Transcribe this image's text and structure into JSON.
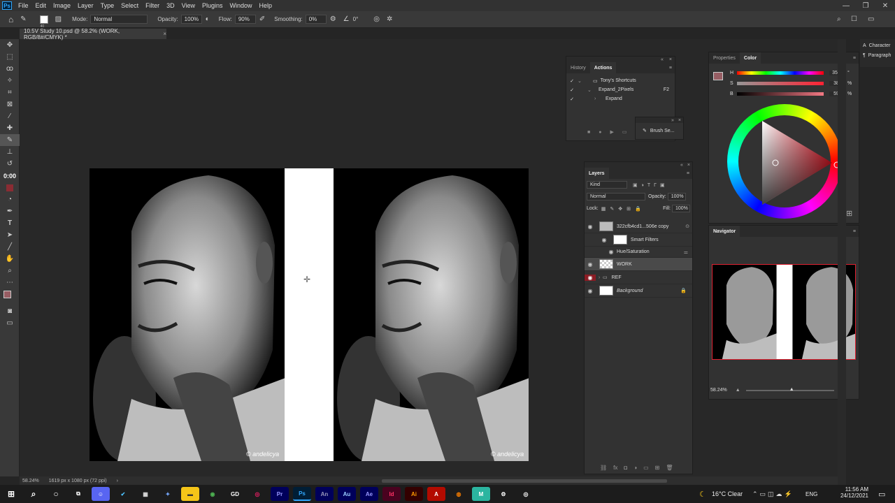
{
  "menu": [
    "File",
    "Edit",
    "Image",
    "Layer",
    "Type",
    "Select",
    "Filter",
    "3D",
    "View",
    "Plugins",
    "Window",
    "Help"
  ],
  "options": {
    "brush_size": "40",
    "mode_label": "Mode:",
    "mode_value": "Normal",
    "opacity_label": "Opacity:",
    "opacity_value": "100%",
    "flow_label": "Flow:",
    "flow_value": "90%",
    "smoothing_label": "Smoothing:",
    "smoothing_value": "0%",
    "angle_value": "0°"
  },
  "doc_tab": "10.5V Study 10.psd @ 58.2% (WORK, RGB/8#/CMYK) *",
  "timer": "0:00",
  "canvas": {
    "watermark": "© andelicya"
  },
  "history": {
    "tabs": [
      "History",
      "Actions"
    ],
    "actions": [
      {
        "label": "Tony's Shortcuts",
        "key": ""
      },
      {
        "label": "Expand_2Pixels",
        "key": "F2"
      },
      {
        "label": "Expand",
        "key": ""
      }
    ],
    "brush_settings": "Brush Se..."
  },
  "color_panel": {
    "tabs": [
      "Properties",
      "Color"
    ],
    "h_label": "H",
    "h_value": "355",
    "h_unit": "°",
    "s_label": "S",
    "s_value": "38",
    "s_unit": "%",
    "b_label": "B",
    "b_value": "59",
    "b_unit": "%",
    "fg_color": "#975d63"
  },
  "side_panel": [
    "Character",
    "Paragraph"
  ],
  "layers": {
    "title": "Layers",
    "kind": "Kind",
    "blend": "Normal",
    "opacity_label": "Opacity:",
    "opacity_value": "100%",
    "lock_label": "Lock:",
    "fill_label": "Fill:",
    "fill_value": "100%",
    "items": [
      {
        "name": "322cfb4cd1...506e copy"
      },
      {
        "name": "Smart Filters"
      },
      {
        "name": "Hue/Saturation"
      },
      {
        "name": "WORK"
      },
      {
        "name": "REF"
      },
      {
        "name": "Background"
      }
    ]
  },
  "navigator": {
    "title": "Navigator",
    "zoom": "58.24%"
  },
  "status": {
    "zoom": "58.24%",
    "size": "1619 px x 1080 px (72 ppi)"
  },
  "taskbar": {
    "apps": [
      "GD",
      "Pr",
      "Ps",
      "An",
      "Au",
      "Ae",
      "Id",
      "Ai"
    ],
    "weather": "16°C  Clear",
    "lang": "ENG",
    "time": "11:56 AM",
    "date": "24/12/2021"
  }
}
